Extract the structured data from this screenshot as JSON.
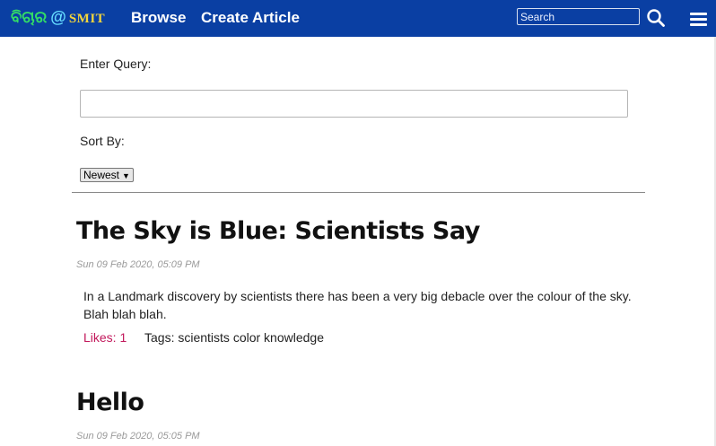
{
  "colors": {
    "topbar": "#0a3fa3",
    "brand_green": "#33dd66",
    "brand_at": "#66ddff",
    "brand_smit": "#f2d53c",
    "likes": "#c2185b"
  },
  "header": {
    "brand": {
      "word": "ବିଚାର",
      "at": "@",
      "org": "SMIT"
    },
    "nav": {
      "browse": "Browse",
      "create": "Create Article"
    },
    "search": {
      "placeholder": "Search",
      "value": ""
    },
    "icons": {
      "search": "search-icon",
      "menu": "hamburger-menu-icon"
    }
  },
  "filters": {
    "query_label": "Enter Query:",
    "query_value": "",
    "sort_label": "Sort By:",
    "sort_value": "Newest"
  },
  "articles": [
    {
      "title": "The Sky is Blue: Scientists Say",
      "date": "Sun 09 Feb 2020, 05:09 PM",
      "body": "In a Landmark discovery by scientists there has been a very big debacle over the colour of the sky. Blah blah blah.",
      "likes_label": "Likes:",
      "likes": "1",
      "tags_label": "Tags:",
      "tags": "scientists color knowledge"
    },
    {
      "title": "Hello",
      "date": "Sun 09 Feb 2020, 05:05 PM"
    }
  ]
}
